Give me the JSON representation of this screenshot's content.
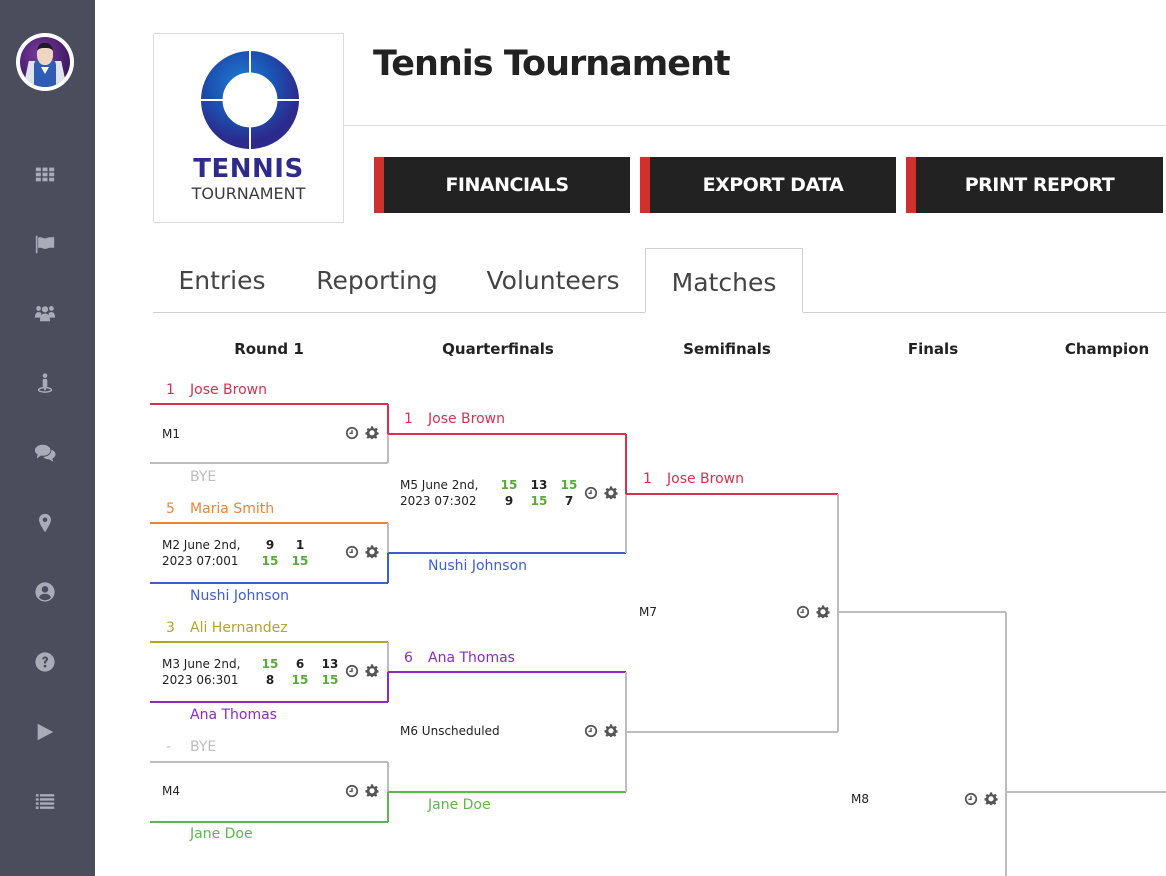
{
  "sidebar": {
    "avatar_alt": "user avatar",
    "items": [
      {
        "icon": "grid-icon",
        "label": "Dashboard"
      },
      {
        "icon": "flag-icon",
        "label": "Tournaments"
      },
      {
        "icon": "users-icon",
        "label": "Teams"
      },
      {
        "icon": "player-icon",
        "label": "Players"
      },
      {
        "icon": "chat-icon",
        "label": "Messages"
      },
      {
        "icon": "map-marker-icon",
        "label": "Locations"
      },
      {
        "icon": "user-circle-icon",
        "label": "Profile"
      },
      {
        "icon": "question-icon",
        "label": "Help"
      },
      {
        "icon": "play-icon",
        "label": "Play"
      },
      {
        "icon": "list-icon",
        "label": "List"
      }
    ]
  },
  "logo": {
    "line1": "TENNIS",
    "line2": "TOURNAMENT"
  },
  "header": {
    "title": "Tennis Tournament"
  },
  "actions": {
    "financials": "FINANCIALS",
    "export": "EXPORT DATA",
    "print": "PRINT REPORT",
    "accent_color": "#d0312d"
  },
  "tabs": [
    {
      "label": "Entries",
      "active": false
    },
    {
      "label": "Reporting",
      "active": false
    },
    {
      "label": "Volunteers",
      "active": false
    },
    {
      "label": "Matches",
      "active": true
    }
  ],
  "rounds": [
    "Round 1",
    "Quarterfinals",
    "Semifinals",
    "Finals",
    "Champion"
  ],
  "colors": {
    "red": "#d9304f",
    "orange": "#e8853a",
    "blue": "#3f5fd1",
    "olive": "#b5a32e",
    "purple": "#8a2cc0",
    "green": "#5cb84a",
    "gray": "#bdbdbd",
    "win_score": "#5aaa3a",
    "lose_score": "#222222"
  },
  "matches": {
    "m1": {
      "label": "M1",
      "top": {
        "seed": "1",
        "name": "Jose Brown"
      },
      "bottom": {
        "seed": "",
        "name": "BYE"
      }
    },
    "m2": {
      "label_line1": "M2 June 2nd,",
      "label_line2": "2023 07:001",
      "top": {
        "seed": "5",
        "name": "Maria Smith"
      },
      "bottom": {
        "seed": "",
        "name": "Nushi Johnson"
      },
      "scores_top": [
        "9",
        "1"
      ],
      "scores_bottom": [
        "15",
        "15"
      ]
    },
    "m3": {
      "label_line1": "M3 June 2nd,",
      "label_line2": "2023 06:301",
      "top": {
        "seed": "3",
        "name": "Ali Hernandez"
      },
      "bottom": {
        "seed": "",
        "name": "Ana Thomas"
      },
      "scores_top": [
        "15",
        "6",
        "13"
      ],
      "scores_bottom": [
        "8",
        "15",
        "15"
      ]
    },
    "m4": {
      "label": "M4",
      "top": {
        "seed": "-",
        "name": "BYE"
      },
      "bottom": {
        "seed": "",
        "name": "Jane Doe"
      }
    },
    "m5": {
      "label_line1": "M5 June 2nd,",
      "label_line2": "2023 07:302",
      "top": {
        "seed": "1",
        "name": "Jose Brown"
      },
      "bottom": {
        "seed": "",
        "name": "Nushi Johnson"
      },
      "scores_top": [
        "15",
        "13",
        "15"
      ],
      "scores_bottom": [
        "9",
        "15",
        "7"
      ]
    },
    "m6": {
      "label": "M6 Unscheduled",
      "top": {
        "seed": "6",
        "name": "Ana Thomas"
      },
      "bottom": {
        "seed": "",
        "name": "Jane Doe"
      }
    },
    "m7": {
      "label": "M7",
      "top": {
        "seed": "1",
        "name": "Jose Brown"
      }
    },
    "m8": {
      "label": "M8"
    }
  }
}
